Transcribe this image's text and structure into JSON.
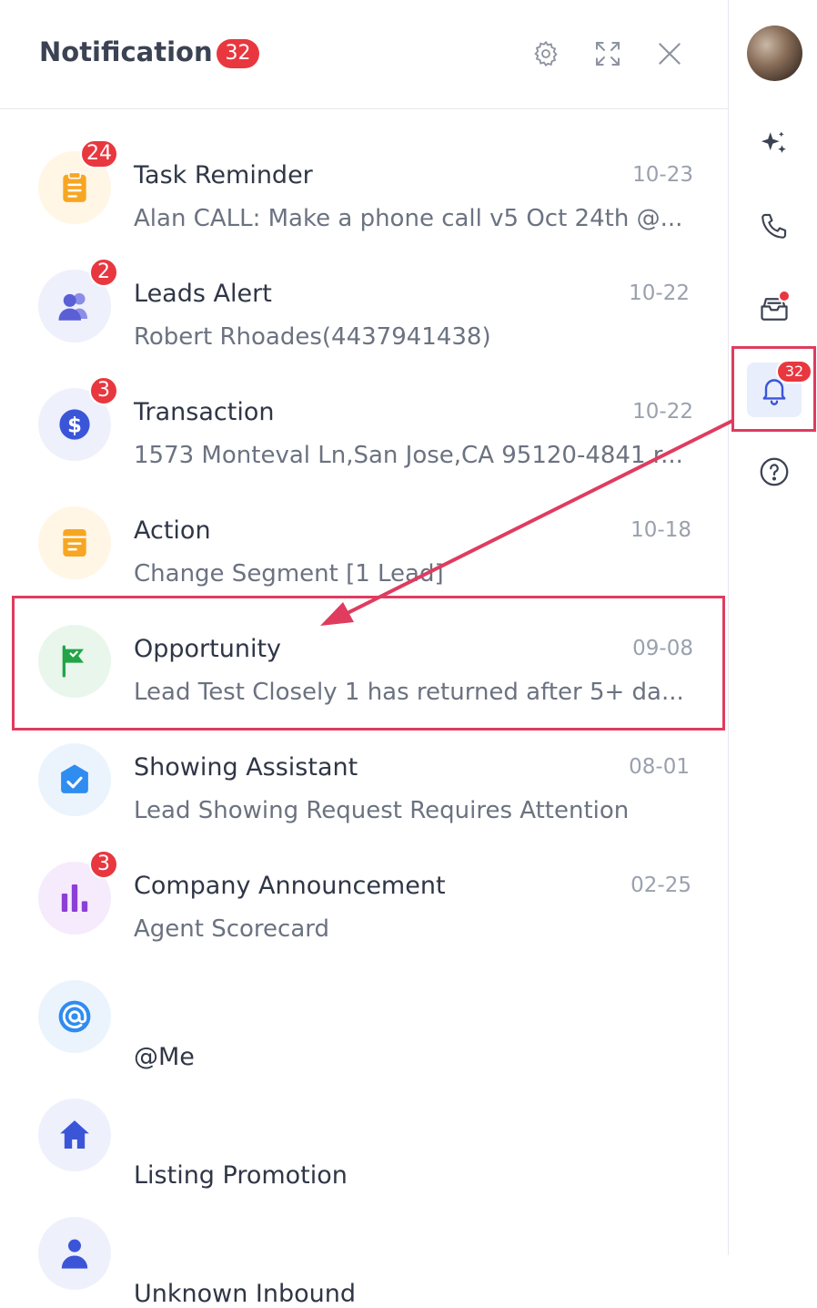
{
  "header": {
    "title": "Notification",
    "count": "32",
    "icons": [
      "gear-icon",
      "expand-icon",
      "close-icon"
    ]
  },
  "notifications": [
    {
      "title": "Task Reminder",
      "date": "10-23",
      "subtitle": "Alan CALL: Make a phone call v5 Oct 24th @...",
      "badge": "24",
      "icon": "clipboard-icon",
      "icon_color": "#f7a623",
      "bg": "#fff6e6"
    },
    {
      "title": "Leads Alert",
      "date": "10-22",
      "subtitle": "Robert Rhoades(4437941438)",
      "badge": "2",
      "icon": "users-icon",
      "icon_color": "#5b5fd6",
      "bg": "#eef0fb"
    },
    {
      "title": "Transaction",
      "date": "10-22",
      "subtitle": "1573 Monteval Ln,San Jose,CA 95120-4841 r...",
      "badge": "3",
      "icon": "dollar-icon",
      "icon_color": "#3b55d9",
      "bg": "#eef1fb"
    },
    {
      "title": "Action",
      "date": "10-18",
      "subtitle": "Change Segment [1 Lead]",
      "badge": "",
      "icon": "document-icon",
      "icon_color": "#f7a623",
      "bg": "#fff6e6"
    },
    {
      "title": "Opportunity",
      "date": "09-08",
      "subtitle": "Lead Test Closely 1 has returned after 5+ da...",
      "badge": "",
      "icon": "flag-icon",
      "icon_color": "#22a447",
      "bg": "#e9f6ec"
    },
    {
      "title": "Showing Assistant",
      "date": "08-01",
      "subtitle": "Lead Showing Request Requires Attention",
      "badge": "",
      "icon": "checkbox-icon",
      "icon_color": "#2f8cf0",
      "bg": "#ebf4fd"
    },
    {
      "title": "Company Announcement",
      "date": "02-25",
      "subtitle": "Agent Scorecard",
      "badge": "3",
      "icon": "bar-chart-icon",
      "icon_color": "#8b3fd6",
      "bg": "#f5ebfc"
    },
    {
      "title": "@Me",
      "date": "",
      "subtitle": "",
      "badge": "",
      "icon": "at-icon",
      "icon_color": "#2f8cf0",
      "bg": "#ebf4fd"
    },
    {
      "title": "Listing Promotion",
      "date": "",
      "subtitle": "",
      "badge": "",
      "icon": "home-icon",
      "icon_color": "#3b55d9",
      "bg": "#eef1fb"
    },
    {
      "title": "Unknown Inbound",
      "date": "",
      "subtitle": "",
      "badge": "",
      "icon": "person-icon",
      "icon_color": "#3b55d9",
      "bg": "#eef1fb"
    }
  ],
  "rail": {
    "bell_badge": "32",
    "icons": [
      "user-avatar",
      "sparkle-icon",
      "phone-icon",
      "inbox-icon",
      "bell-icon",
      "help-icon"
    ]
  },
  "colors": {
    "accent_red": "#e8373f",
    "highlight": "#df3c5f"
  }
}
